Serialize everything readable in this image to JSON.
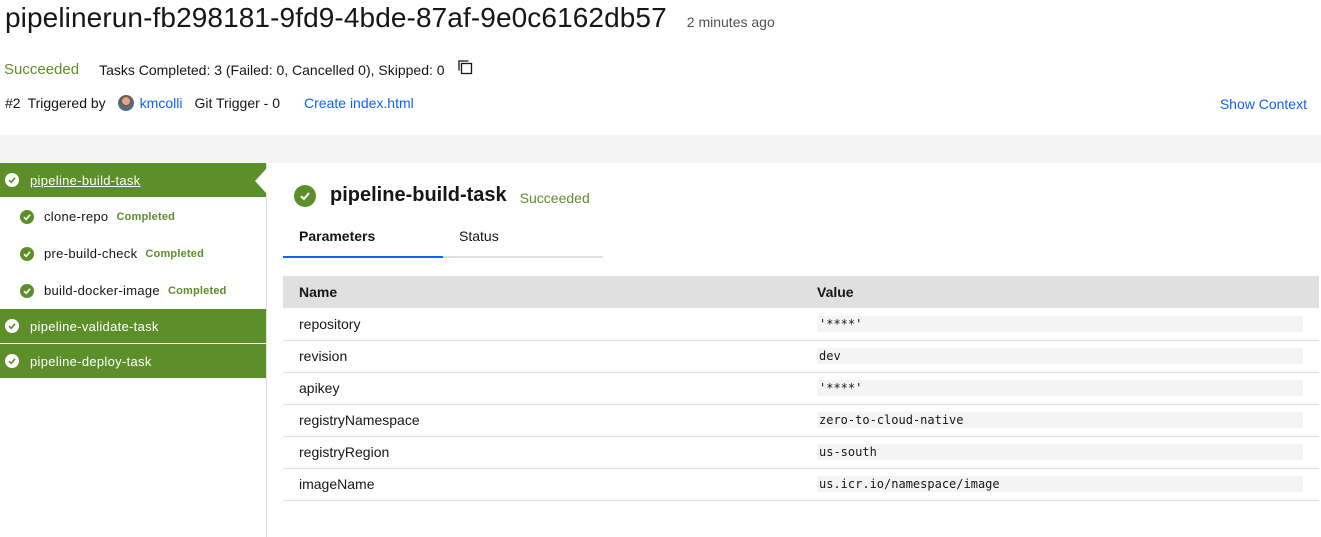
{
  "run": {
    "title": "pipelinerun-fb298181-9fd9-4bde-87af-9e0c6162db57",
    "age": "2 minutes ago",
    "status": "Succeeded",
    "tasks_summary": "Tasks Completed: 3 (Failed: 0, Cancelled 0), Skipped: 0",
    "number": "#2",
    "triggered_by_label": "Triggered by",
    "user": "kmcolli",
    "git_trigger": "Git Trigger - 0",
    "commit_message": "Create index.html",
    "show_context": "Show Context"
  },
  "colors": {
    "success": "#5c8f2a",
    "link": "#0f62fe",
    "band": "#f4f4f4"
  },
  "sidebar": {
    "tasks": [
      {
        "label": "pipeline-build-task",
        "selected": true,
        "steps": [
          {
            "label": "clone-repo",
            "status": "Completed"
          },
          {
            "label": "pre-build-check",
            "status": "Completed"
          },
          {
            "label": "build-docker-image",
            "status": "Completed"
          }
        ]
      },
      {
        "label": "pipeline-validate-task",
        "selected": false,
        "steps": []
      },
      {
        "label": "pipeline-deploy-task",
        "selected": false,
        "steps": []
      }
    ]
  },
  "detail": {
    "title": "pipeline-build-task",
    "status": "Succeeded",
    "tabs": [
      {
        "label": "Parameters",
        "active": true
      },
      {
        "label": "Status",
        "active": false
      }
    ],
    "table": {
      "headers": {
        "name": "Name",
        "value": "Value"
      },
      "rows": [
        {
          "name": "repository",
          "value": "'****'"
        },
        {
          "name": "revision",
          "value": "dev"
        },
        {
          "name": "apikey",
          "value": "'****'"
        },
        {
          "name": "registryNamespace",
          "value": "zero-to-cloud-native"
        },
        {
          "name": "registryRegion",
          "value": "us-south"
        },
        {
          "name": "imageName",
          "value": "us.icr.io/namespace/image"
        }
      ]
    }
  }
}
